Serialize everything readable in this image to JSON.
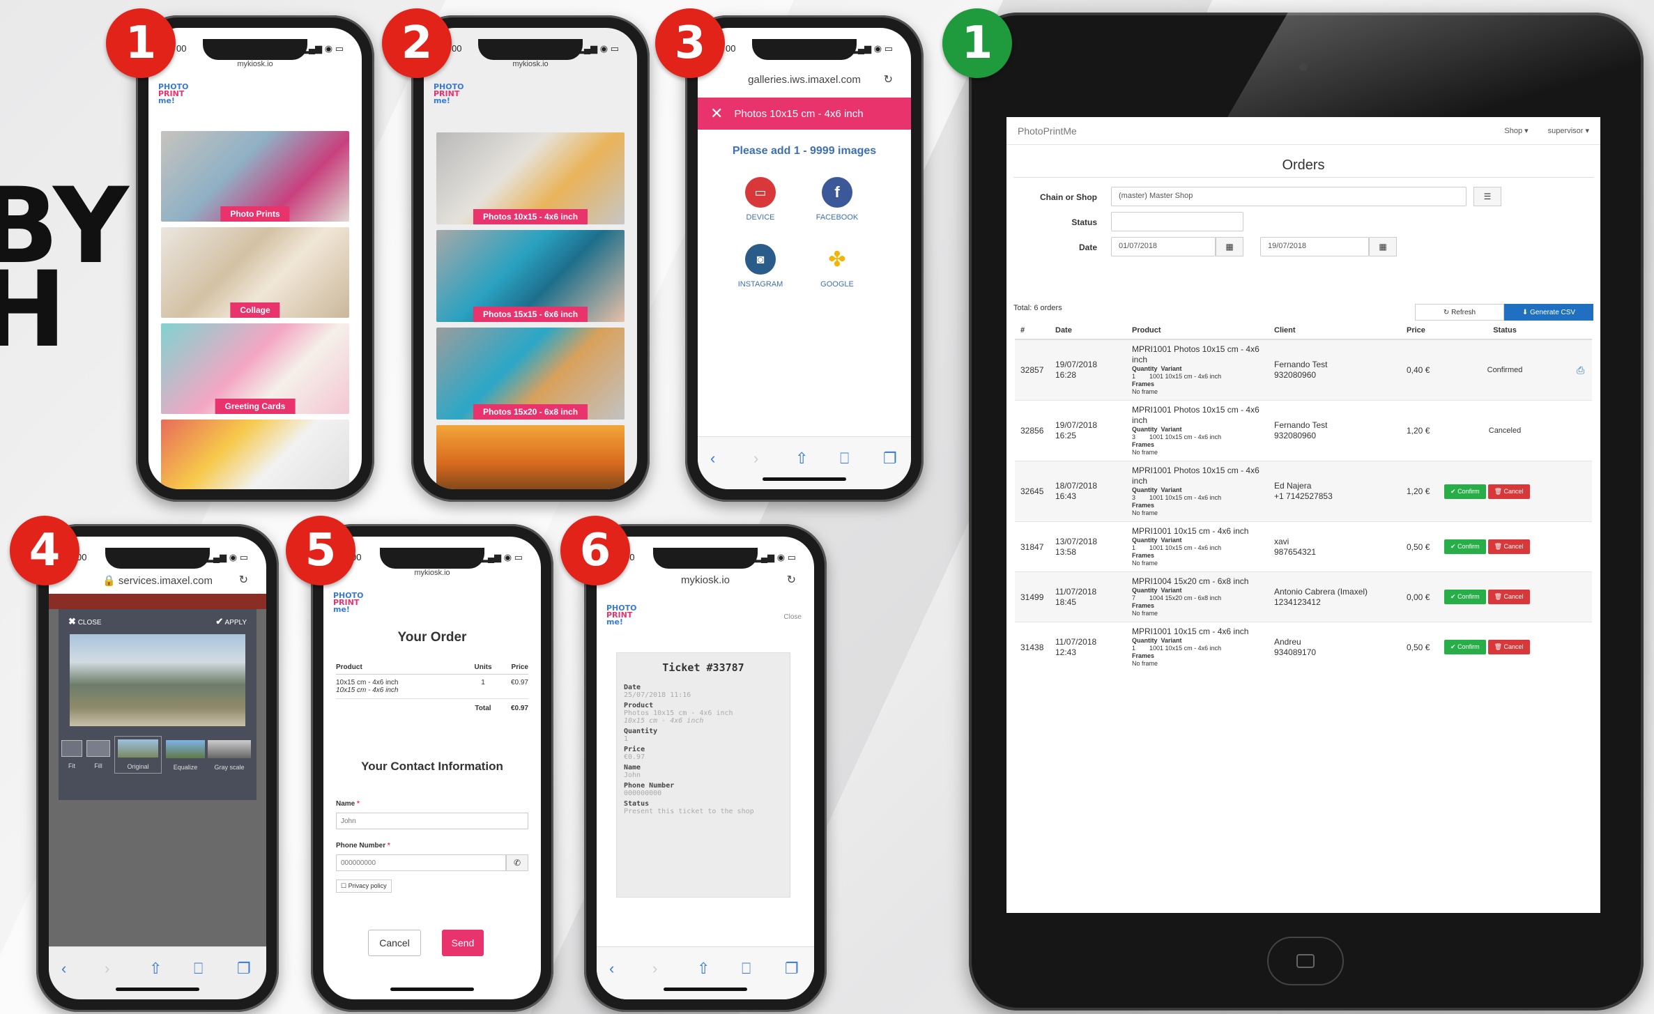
{
  "hero_text": [
    "BY",
    "H"
  ],
  "badges": [
    "1",
    "2",
    "3",
    "4",
    "5",
    "6",
    "1"
  ],
  "phone1": {
    "status_time": "00",
    "url": "mykiosk.io",
    "logo": [
      "PHOTO",
      "PRINT",
      "me!"
    ],
    "tiles": [
      "Photo Prints",
      "Collage",
      "Greeting Cards"
    ]
  },
  "phone2": {
    "status_time": "00",
    "url": "mykiosk.io",
    "logo": [
      "PHOTO",
      "PRINT",
      "me!"
    ],
    "tiles": [
      "Photos 10x15 - 4x6 inch",
      "Photos 15x15 - 6x6 inch",
      "Photos 15x20 - 6x8 inch"
    ]
  },
  "phone3": {
    "status_time": "00",
    "url": "galleries.iws.imaxel.com",
    "header": "Photos 10x15 cm - 4x6 inch",
    "prompt": "Please add 1 - 9999 images",
    "sources": [
      "DEVICE",
      "FACEBOOK",
      "INSTAGRAM",
      "GOOGLE"
    ]
  },
  "phone4": {
    "status_time": "00",
    "url": "services.imaxel.com",
    "close": "CLOSE",
    "apply": "APPLY",
    "filters": [
      "Fit",
      "Fill",
      "Original",
      "Equalize",
      "Gray scale"
    ]
  },
  "phone5": {
    "status_time": "00",
    "url": "mykiosk.io",
    "title": "Your Order",
    "headers": [
      "Product",
      "Units",
      "Price"
    ],
    "row_product": "10x15 cm - 4x6 inch",
    "row_product_sub": "10x15 cm - 4x6 inch",
    "row_units": "1",
    "row_price": "€0.97",
    "total_label": "Total",
    "total_value": "€0.97",
    "contact_title": "Your Contact Information",
    "name_label": "Name",
    "name_value": "John",
    "phone_label": "Phone Number",
    "phone_value": "000000000",
    "privacy": "Privacy policy",
    "cancel": "Cancel",
    "send": "Send"
  },
  "phone6": {
    "status_time": "00",
    "url": "mykiosk.io",
    "close": "Close",
    "logo": [
      "PHOTO",
      "PRINT",
      "me!"
    ],
    "ticket_title": "Ticket #33787",
    "fields": [
      {
        "k": "Date",
        "v": "25/07/2018 11:16"
      },
      {
        "k": "Product",
        "v": "Photos 10x15 cm - 4x6 inch",
        "v2": "10x15 cm - 4x6 inch"
      },
      {
        "k": "Quantity",
        "v": "1"
      },
      {
        "k": "Price",
        "v": "€0.97"
      },
      {
        "k": "Name",
        "v": "John"
      },
      {
        "k": "Phone Number",
        "v": "000000000"
      },
      {
        "k": "Status",
        "v": "Present this ticket to the shop"
      }
    ]
  },
  "tablet": {
    "brand": "PhotoPrintMe",
    "nav_shop": "Shop ▾",
    "nav_user": "supervisor ▾",
    "title": "Orders",
    "filter_labels": {
      "chain": "Chain or Shop",
      "status": "Status",
      "date": "Date"
    },
    "chain_value": "(master) Master Shop",
    "date_from": "01/07/2018",
    "date_to": "19/07/2018",
    "total": "Total: 6 orders",
    "refresh": "Refresh",
    "generate": "Generate CSV",
    "columns": [
      "#",
      "Date",
      "Product",
      "Client",
      "Price",
      "Status"
    ],
    "orders": [
      {
        "id": "32857",
        "date": "19/07/2018",
        "time": "16:28",
        "product": "MPRI1001 Photos 10x15 cm - 4x6 inch",
        "qty": "1",
        "variant": "1001 10x15 cm - 4x6 inch",
        "frames": "No frame",
        "client": "Fernando Test",
        "phone": "932080960",
        "price": "0,40 €",
        "status": "Confirmed"
      },
      {
        "id": "32856",
        "date": "19/07/2018",
        "time": "16:25",
        "product": "MPRI1001 Photos 10x15 cm - 4x6 inch",
        "qty": "3",
        "variant": "1001 10x15 cm - 4x6 inch",
        "frames": "No frame",
        "client": "Fernando Test",
        "phone": "932080960",
        "price": "1,20 €",
        "status": "Canceled"
      },
      {
        "id": "32645",
        "date": "18/07/2018",
        "time": "16:43",
        "product": "MPRI1001 Photos 10x15 cm - 4x6 inch",
        "qty": "3",
        "variant": "1001 10x15 cm - 4x6 inch",
        "frames": "No frame",
        "client": "Ed Najera",
        "phone": "+1 7142527853",
        "price": "1,20 €",
        "status": ""
      },
      {
        "id": "31847",
        "date": "13/07/2018",
        "time": "13:58",
        "product": "MPRI1001 10x15 cm - 4x6 inch",
        "qty": "1",
        "variant": "1001 10x15 cm - 4x6 inch",
        "frames": "No frame",
        "client": "xavi",
        "phone": "987654321",
        "price": "0,50 €",
        "status": ""
      },
      {
        "id": "31499",
        "date": "11/07/2018",
        "time": "18:45",
        "product": "MPRI1004 15x20 cm - 6x8 inch",
        "qty": "7",
        "variant": "1004 15x20 cm - 6x8 inch",
        "frames": "No frame",
        "client": "Antonio Cabrera (Imaxel)",
        "phone": "1234123412",
        "price": "0,00 €",
        "status": ""
      },
      {
        "id": "31438",
        "date": "11/07/2018",
        "time": "12:43",
        "product": "MPRI1001 10x15 cm - 4x6 inch",
        "qty": "1",
        "variant": "1001 10x15 cm - 4x6 inch",
        "frames": "No frame",
        "client": "Andreu",
        "phone": "934089170",
        "price": "0,50 €",
        "status": ""
      }
    ],
    "sub_labels": {
      "quantity": "Quantity",
      "variant": "Variant",
      "frames": "Frames"
    },
    "confirm": "Confirm",
    "cancel": "Cancel"
  },
  "colors": {
    "pink": "#e8336d",
    "badge_red": "#e2231a",
    "badge_green": "#1f9a3c",
    "blue": "#1f70c1",
    "confirm": "#27ae48",
    "cancel": "#d9383a"
  }
}
